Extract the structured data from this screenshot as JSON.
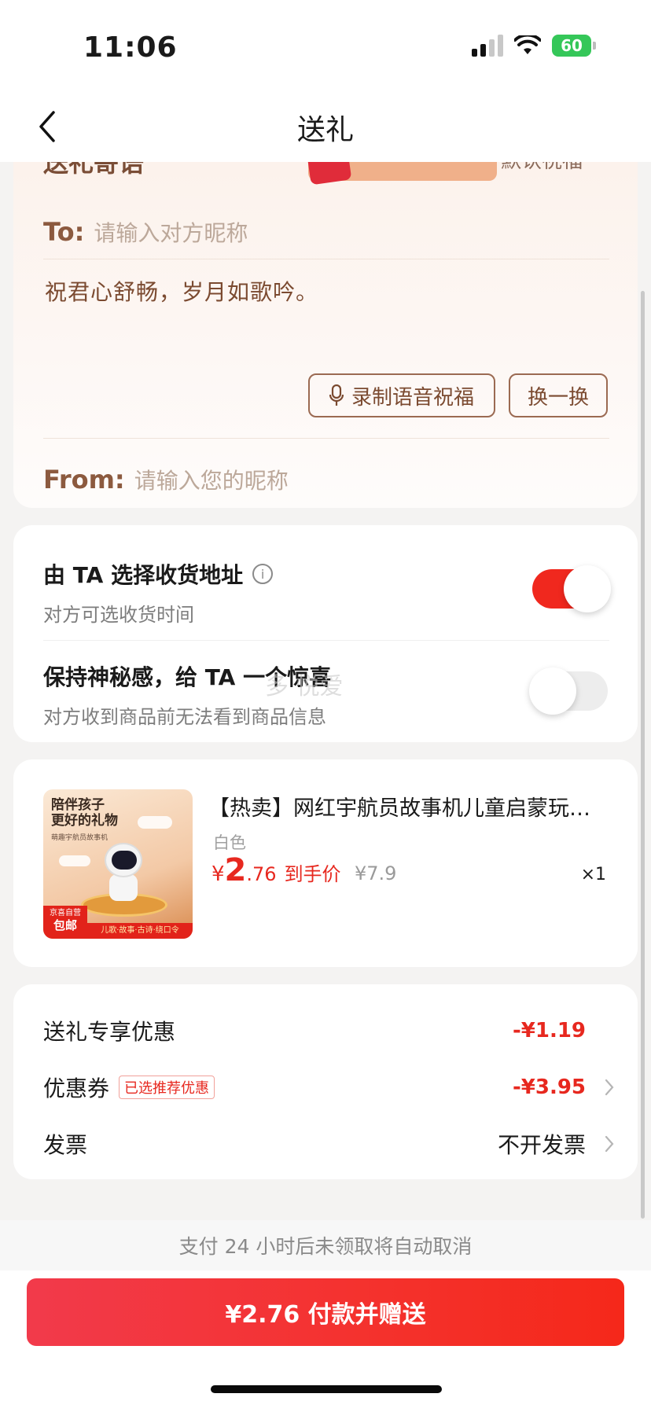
{
  "status_bar": {
    "time": "11:06",
    "battery": "60"
  },
  "nav": {
    "title": "送礼"
  },
  "message_card": {
    "header_partial": "送礼寄语",
    "header_right_partial": "默认祝福",
    "to_label": "To:",
    "to_placeholder": "请输入对方昵称",
    "message": "祝君心舒畅，岁月如歌吟。",
    "voice_button": "录制语音祝福",
    "swap_button": "换一换",
    "from_label": "From:",
    "from_placeholder": "请输入您的昵称"
  },
  "toggles": {
    "address": {
      "title": "由 TA 选择收货地址",
      "subtitle": "对方可选收货时间",
      "on": true
    },
    "mystery": {
      "title": "保持神秘感，给 TA 一个惊喜",
      "subtitle": "对方收到商品前无法看到商品信息",
      "on": false
    },
    "watermark": "多 悦爱"
  },
  "product": {
    "title": "【热卖】网红宇航员故事机儿童启蒙玩具…",
    "spec": "白色",
    "price_currency": "¥",
    "price_int": "2",
    "price_dec": ".76",
    "price_tag": "到手价",
    "original_price": "¥7.9",
    "quantity": "×1",
    "thumb": {
      "headline_1": "陪伴孩子",
      "headline_2": "更好的礼物",
      "sub": "萌趣宇航员故事机",
      "badge_top": "京喜自营",
      "badge_bottom": "包邮",
      "footer": "儿歌·故事·古诗·绕口令"
    }
  },
  "summary": {
    "gift_discount_label": "送礼专享优惠",
    "gift_discount_value": "-¥1.19",
    "coupon_label": "优惠券",
    "coupon_badge": "已选推荐优惠",
    "coupon_value": "-¥3.95",
    "invoice_label": "发票",
    "invoice_value": "不开发票"
  },
  "footer": {
    "notice": "支付 24 小时后未领取将自动取消",
    "pay_button": "¥2.76 付款并赠送"
  },
  "colors": {
    "accent": "#f0281e",
    "price": "#e7281f",
    "message_text": "#7b4a30"
  }
}
